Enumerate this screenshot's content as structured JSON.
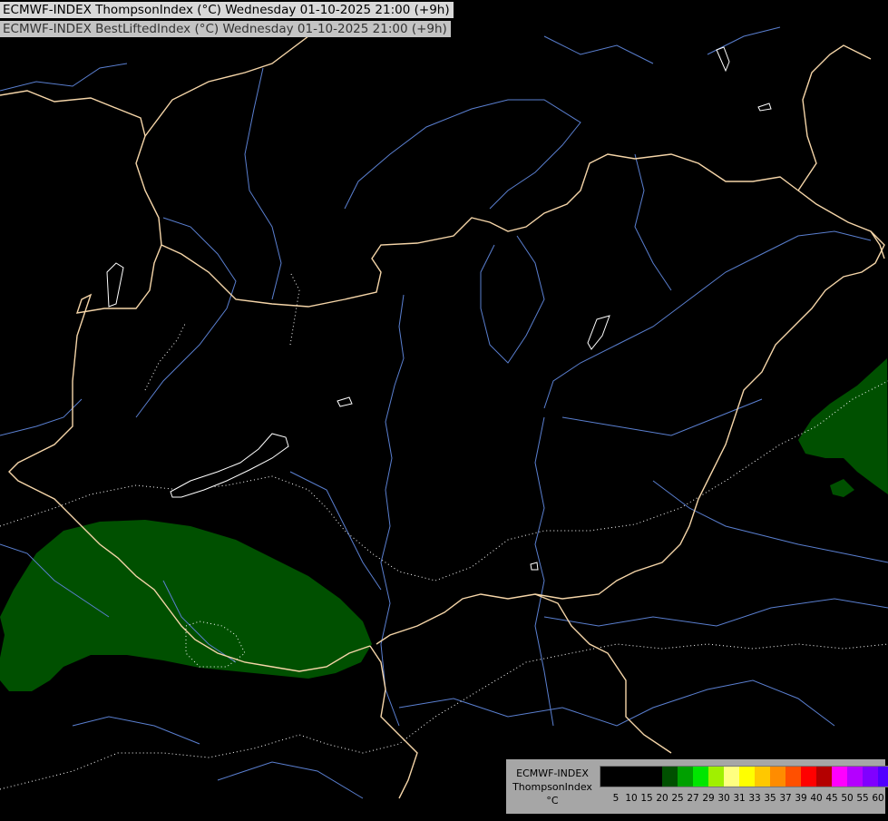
{
  "header": {
    "title_primary": "ECMWF-INDEX ThompsonIndex (°C) Wednesday 01-10-2025 21:00 (+9h)",
    "title_secondary": "ECMWF-INDEX BestLiftedIndex (°C) Wednesday 01-10-2025 21:00 (+9h)"
  },
  "map": {
    "background_color": "#000000",
    "border_color": "#f5d5a8",
    "river_color": "#5a7fd0",
    "field_fill_color": "#005000",
    "contour_color": "#ffffff",
    "lakes": [
      "Balaton"
    ]
  },
  "legend": {
    "label_line1": "ECMWF-INDEX",
    "label_line2": "ThompsonIndex",
    "label_line3": "°C",
    "ticks": [
      "5",
      "10",
      "15",
      "20",
      "25",
      "27",
      "29",
      "30",
      "31",
      "33",
      "35",
      "37",
      "39",
      "40",
      "45",
      "50",
      "55",
      "60"
    ],
    "colors": [
      "#000000",
      "#000000",
      "#000000",
      "#000000",
      "#005000",
      "#00a000",
      "#00e600",
      "#a0f000",
      "#ffff80",
      "#ffff00",
      "#ffc800",
      "#ff8c00",
      "#ff5000",
      "#ff0000",
      "#b40000",
      "#ff00ff",
      "#b400ff",
      "#8000ff",
      "#5000ff",
      "#0000ff"
    ]
  }
}
